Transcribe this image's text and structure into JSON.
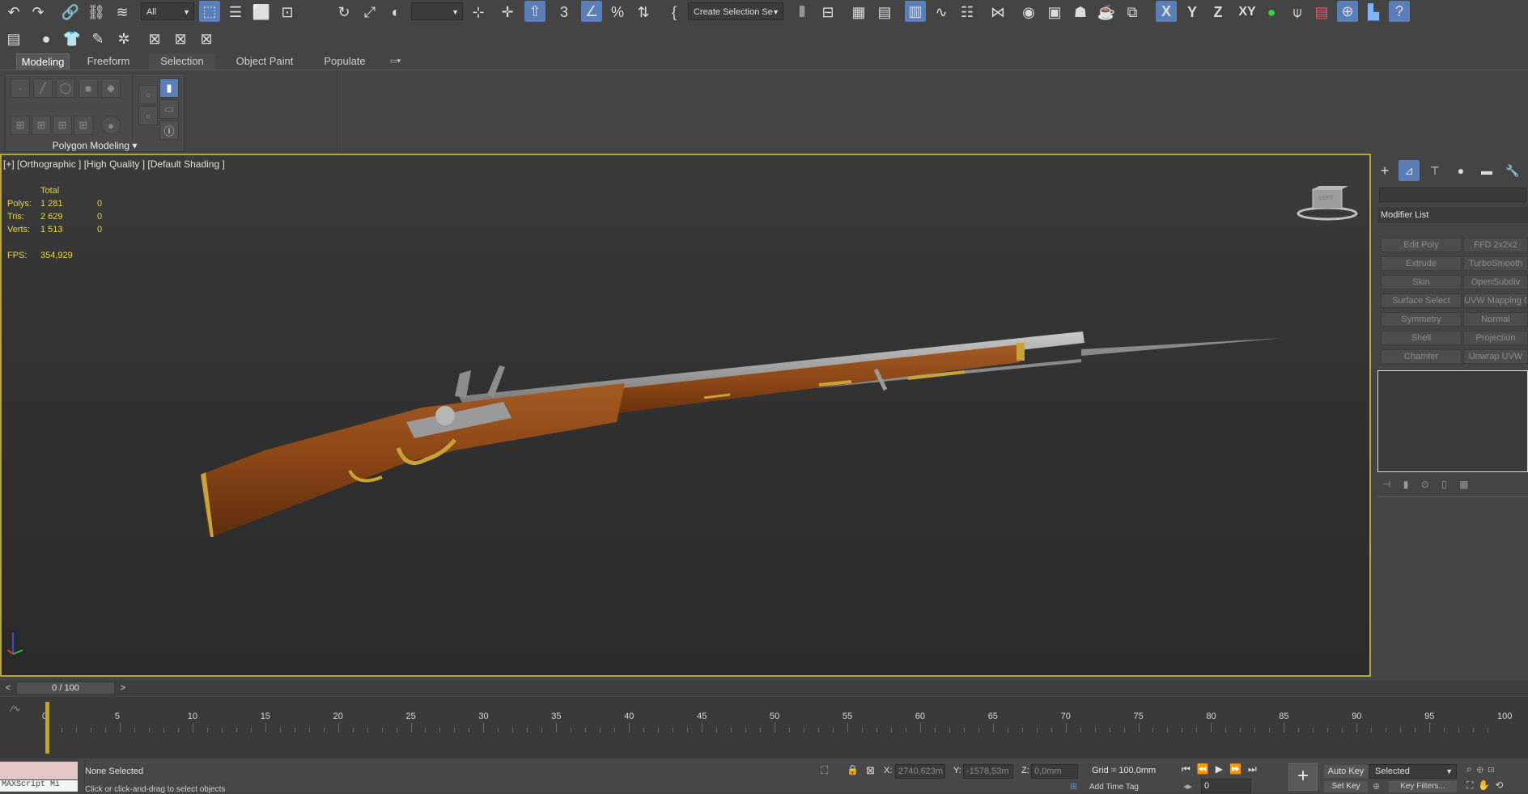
{
  "toolbar": {
    "selection_filter": "All",
    "named_selection": "Create Selection Se",
    "axis_x": "X",
    "axis_y": "Y",
    "axis_z": "Z",
    "axis_xy": "XY",
    "snap_3": "3",
    "percent_icon": "%"
  },
  "ribbon": {
    "tabs": [
      "Modeling",
      "Freeform",
      "Selection",
      "Object Paint",
      "Populate"
    ],
    "panel_label": "Polygon Modeling"
  },
  "viewport": {
    "label": "[+] [Orthographic ] [High Quality ] [Default Shading ]",
    "stats": {
      "header": "Total",
      "polys_label": "Polys:",
      "polys_total": "1 281",
      "polys_sel": "0",
      "tris_label": "Tris:",
      "tris_total": "2 629",
      "tris_sel": "0",
      "verts_label": "Verts:",
      "verts_total": "1 513",
      "verts_sel": "0",
      "fps_label": "FPS:",
      "fps_value": "354,929"
    },
    "viewcube_label": "LEFT"
  },
  "command_panel": {
    "modifier_list_label": "Modifier List",
    "modifiers_left": [
      "Edit Poly",
      "Extrude",
      "Skin",
      "Surface Select",
      "Symmetry",
      "Shell",
      "Chamfer"
    ],
    "modifiers_right": [
      "FFD 2x2x2",
      "TurboSmooth",
      "OpenSubdiv",
      "UVW Mapping Cl",
      "Normal",
      "Projection",
      "Unwrap UVW"
    ]
  },
  "timeline": {
    "frame_display": "0 / 100",
    "ticks": [
      "0",
      "5",
      "10",
      "15",
      "20",
      "25",
      "30",
      "35",
      "40",
      "45",
      "50",
      "55",
      "60",
      "65",
      "70",
      "75",
      "80",
      "85",
      "90",
      "95",
      "100"
    ]
  },
  "status": {
    "selection_text": "None Selected",
    "prompt_text": "Click or click-and-drag to select objects",
    "maxscript_label": "MAXScript Mi",
    "x_label": "X:",
    "x_value": "2740,623m",
    "y_label": "Y:",
    "y_value": "-1578,53m",
    "z_label": "Z:",
    "z_value": "0,0mm",
    "grid_text": "Grid = 100,0mm",
    "add_time_tag": "Add Time Tag",
    "auto_key": "Auto Key",
    "set_key": "Set Key",
    "key_mode": "Selected",
    "key_filters": "Key Filters...",
    "current_frame": "0"
  }
}
